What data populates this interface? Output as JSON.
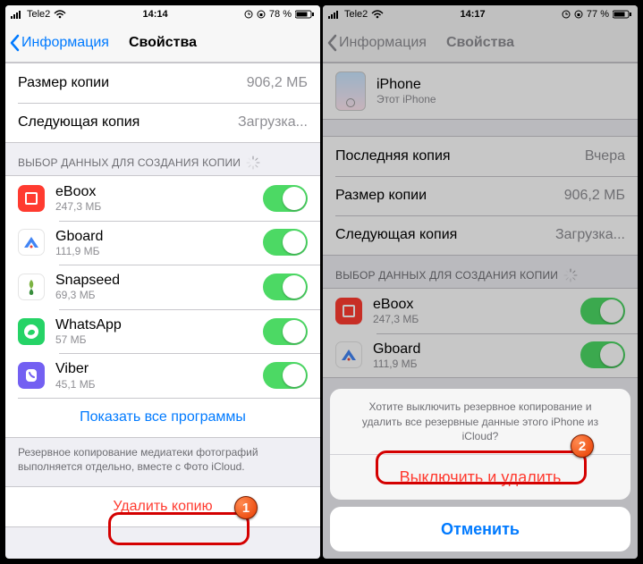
{
  "left": {
    "status": {
      "carrier": "Tele2",
      "time": "14:14",
      "battery_pct": "78 %"
    },
    "nav": {
      "back": "Информация",
      "title": "Свойства"
    },
    "summary": [
      {
        "label": "Размер копии",
        "value": "906,2 МБ"
      },
      {
        "label": "Следующая копия",
        "value": "Загрузка..."
      }
    ],
    "apps_header": "ВЫБОР ДАННЫХ ДЛЯ СОЗДАНИЯ КОПИИ",
    "apps": [
      {
        "name": "eBoox",
        "size": "247,3 МБ",
        "icon_class": "ic-eboox"
      },
      {
        "name": "Gboard",
        "size": "111,9 МБ",
        "icon_class": "ic-gboard"
      },
      {
        "name": "Snapseed",
        "size": "69,3 МБ",
        "icon_class": "ic-snapseed"
      },
      {
        "name": "WhatsApp",
        "size": "57 МБ",
        "icon_class": "ic-whatsapp"
      },
      {
        "name": "Viber",
        "size": "45,1 МБ",
        "icon_class": "ic-viber"
      }
    ],
    "show_all": "Показать все программы",
    "footer": "Резервное копирование медиатеки фотографий выполняется отдельно, вместе с Фото iCloud.",
    "delete": "Удалить копию",
    "badge": "1"
  },
  "right": {
    "status": {
      "carrier": "Tele2",
      "time": "14:17",
      "battery_pct": "77 %"
    },
    "nav": {
      "back": "Информация",
      "title": "Свойства"
    },
    "device": {
      "name": "iPhone",
      "sub": "Этот iPhone"
    },
    "summary": [
      {
        "label": "Последняя копия",
        "value": "Вчера"
      },
      {
        "label": "Размер копии",
        "value": "906,2 МБ"
      },
      {
        "label": "Следующая копия",
        "value": "Загрузка..."
      }
    ],
    "apps_header": "ВЫБОР ДАННЫХ ДЛЯ СОЗДАНИЯ КОПИИ",
    "apps": [
      {
        "name": "eBoox",
        "size": "247,3 МБ",
        "icon_class": "ic-eboox"
      },
      {
        "name": "Gboard",
        "size": "111,9 МБ",
        "icon_class": "ic-gboard"
      }
    ],
    "sheet": {
      "message": "Хотите выключить резервное копирование и удалить все резервные данные этого iPhone из iCloud?",
      "destructive": "Выключить и удалить",
      "cancel": "Отменить"
    },
    "badge": "2"
  }
}
